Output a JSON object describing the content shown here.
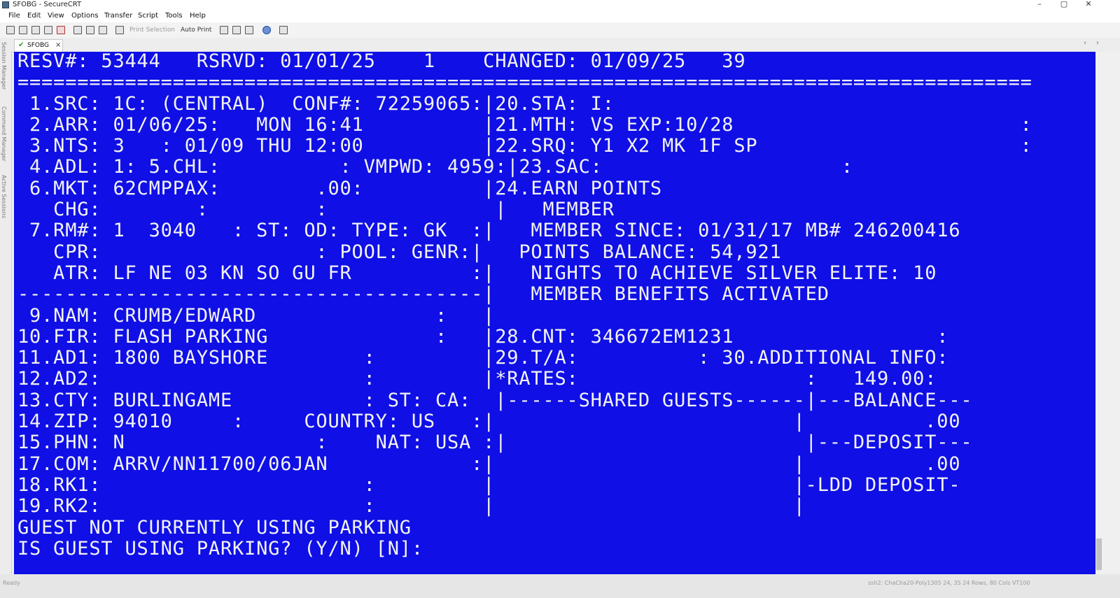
{
  "window": {
    "title": "SFOBG - SecureCRT",
    "minimize": "–",
    "maximize": "▢",
    "close": "✕"
  },
  "menu": [
    "File",
    "Edit",
    "View",
    "Options",
    "Transfer",
    "Script",
    "Tools",
    "Help"
  ],
  "toolbar": {
    "print_selection": "Print Selection",
    "auto_print": "Auto Print"
  },
  "side_panels": [
    "Session Manager",
    "Command Manager",
    "Active Sessions"
  ],
  "tab": {
    "label": "SFOBG",
    "close": "×",
    "scroll_left": "‹",
    "scroll_right": "›"
  },
  "terminal": {
    "background": "#0f0fe6",
    "foreground": "#f2f2f2",
    "lines": [
      "RESV#: 53444   RSRVD: 01/01/25    1    CHANGED: 01/09/25   39",
      "=====================================================================================",
      " 1.SRC: 1C: (CENTRAL)  CONF#: 72259065:|20.STA: I:",
      " 2.ARR: 01/06/25:   MON 16:41          |21.MTH: VS EXP:10/28                        :",
      " 3.NTS: 3   : 01/09 THU 12:00          |22.SRQ: Y1 X2 MK 1F SP                      :",
      " 4.ADL: 1: 5.CHL:          : VMPWD: 4959:|23.SAC:                    :",
      " 6.MKT: 62CMPPAX:        .00:          |24.EARN POINTS",
      "   CHG:        :         :              |   MEMBER",
      " 7.RM#: 1  3040   : ST: OD: TYPE: GK  :|   MEMBER SINCE: 01/31/17 MB# 246200416",
      "   CPR:                  : POOL: GENR:|   POINTS BALANCE: 54,921",
      "   ATR: LF NE 03 KN SO GU FR          :|   NIGHTS TO ACHIEVE SILVER ELITE: 10",
      "---------------------------------------|   MEMBER BENEFITS ACTIVATED",
      " 9.NAM: CRUMB/EDWARD               :   |",
      "10.FIR: FLASH PARKING              :   |28.CNT: 346672EM1231                 :",
      "11.AD1: 1800 BAYSHORE        :         |29.T/A:          : 30.ADDITIONAL INFO:",
      "12.AD2:                      :         |*RATES:                   :   149.00:",
      "13.CTY: BURLINGAME           : ST: CA:  |------SHARED GUESTS------|---BALANCE---",
      "14.ZIP: 94010     :     COUNTRY: US   :|                         |          .00",
      "15.PHN: N                :    NAT: USA :|                         |---DEPOSIT---",
      "17.COM: ARRV/NN11700/06JAN            :|                         |          .00",
      "18.RK1:                      :         |                         |-LDD DEPOSIT-",
      "19.RK2:                      :         |                         |",
      "GUEST NOT CURRENTLY USING PARKING",
      "IS GUEST USING PARKING? (Y/N) [N]:"
    ]
  },
  "status": {
    "left": "Ready",
    "right": "ssh2: ChaCha20-Poly1305   24, 35   24 Rows, 80 Cols   VT100"
  }
}
